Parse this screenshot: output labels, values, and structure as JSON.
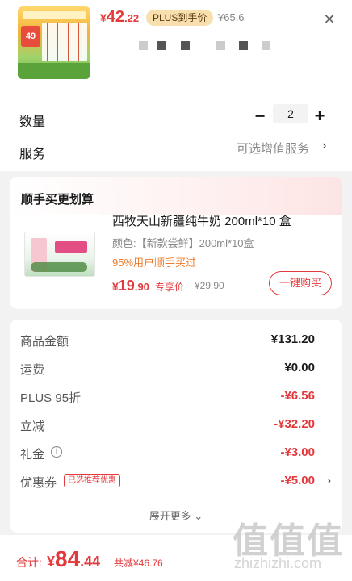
{
  "product": {
    "thumb_badge": "49",
    "price_symbol": "¥",
    "price_int": "42",
    "price_dec": ".22",
    "plus_tag": "PLUS到手价",
    "orig_price": "¥65.6",
    "close_icon": "✕"
  },
  "quantity": {
    "label": "数量",
    "minus": "−",
    "value": "2",
    "plus": "+"
  },
  "service": {
    "label": "服务",
    "value": "可选增值服务",
    "chevron": "›"
  },
  "addon": {
    "title": "顺手买更划算",
    "name": "西牧天山新疆纯牛奶 200ml*10 盒",
    "spec": "颜色:【新款尝鲜】200ml*10盒",
    "promo": "95%用户顺手买过",
    "price_symbol": "¥",
    "price_int": "19",
    "price_dec": ".90",
    "exclusive_label": "专享价",
    "orig_price": "¥29.90",
    "buy_label": "一键购买"
  },
  "summary": {
    "rows": [
      {
        "label": "商品金额",
        "value": "¥131.20"
      },
      {
        "label": "运费",
        "value": "¥0.00"
      },
      {
        "label": "PLUS 95折",
        "value": "-¥6.56"
      },
      {
        "label": "立减",
        "value": "-¥32.20"
      },
      {
        "label": "礼金",
        "value": "-¥3.00",
        "info_icon": "ⓘ"
      },
      {
        "label": "优惠券",
        "value": "-¥5.00",
        "tag": "已选推荐优惠",
        "chevron": "›"
      }
    ],
    "expand_label": "展开更多 ⌄"
  },
  "footer": {
    "total_label": "合计:",
    "price_symbol": "¥",
    "price_int": "84",
    "price_dec": ".44",
    "saved": "共减¥46.76"
  },
  "watermark": {
    "logo": "值值值",
    "url": "zhizhizhi.com"
  },
  "colors": {
    "accent": "#e4393c",
    "plus_tag_bg": "#f7e0ad",
    "promo": "#f07b2a",
    "background": "#f2f2f2"
  }
}
